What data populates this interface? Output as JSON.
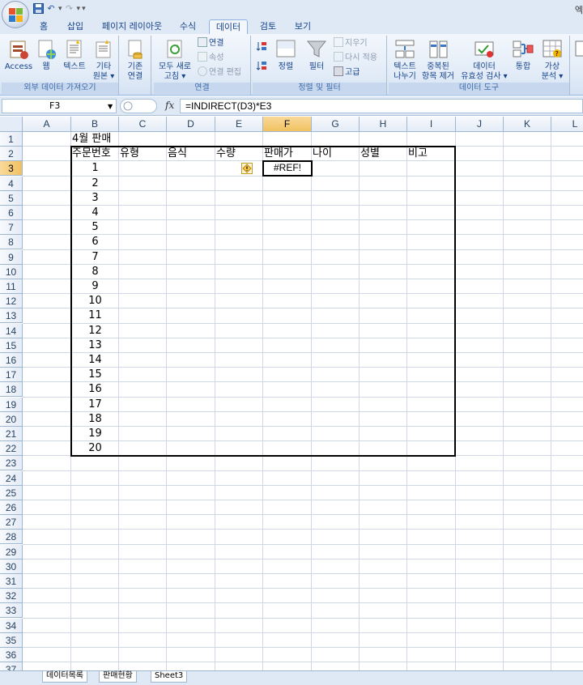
{
  "title_right": "엑",
  "qat": {
    "save": "💾",
    "undo": "↶",
    "redo": "↷",
    "more": "▾"
  },
  "tabs": [
    "홈",
    "삽입",
    "페이지 레이아웃",
    "수식",
    "데이터",
    "검토",
    "보기"
  ],
  "active_tab": "데이터",
  "ribbon": {
    "groups": {
      "external": {
        "label": "외부 데이터 가져오기",
        "buttons": [
          "Access",
          "웹",
          "텍스트",
          "기타",
          "원본 ▾"
        ]
      },
      "existing": {
        "line1": "기존",
        "line2": "연결"
      },
      "connections": {
        "label": "연결",
        "refresh_line1": "모두 새로",
        "refresh_line2": "고침 ▾",
        "connect": "연결",
        "properties": "속성",
        "edit_links": "연결 편집"
      },
      "sort_filter": {
        "label": "정렬 및 필터",
        "sort": "정렬",
        "filter": "필터",
        "clear": "지우기",
        "reapply": "다시 적용",
        "advanced": "고급"
      },
      "data_tools": {
        "label": "데이터 도구",
        "text_to_columns_1": "텍스트",
        "text_to_columns_2": "나누기",
        "remove_dup_1": "중복된",
        "remove_dup_2": "항목 제거",
        "validation_1": "데이터",
        "validation_2": "유효성 검사 ▾",
        "consolidate": "통합",
        "whatif_1": "가상",
        "whatif_2": "분석 ▾"
      }
    }
  },
  "formula_bar": {
    "name_box": "F3",
    "fx": "fx",
    "formula": "=INDIRECT(D3)*E3"
  },
  "columns": [
    "A",
    "B",
    "C",
    "D",
    "E",
    "F",
    "G",
    "H",
    "I",
    "J",
    "K",
    "L"
  ],
  "selected_column": "F",
  "selected_row": "3",
  "rows": [
    "1",
    "2",
    "3",
    "4",
    "5",
    "6",
    "7",
    "8",
    "9",
    "10",
    "11",
    "12",
    "13",
    "14",
    "15",
    "16",
    "17",
    "18",
    "19",
    "20",
    "21",
    "22",
    "23",
    "24",
    "25",
    "26",
    "27",
    "28",
    "29",
    "30",
    "31",
    "32",
    "33",
    "34",
    "35",
    "36",
    "37"
  ],
  "sheet": {
    "title": "4월 판매",
    "headers": [
      "주문번호",
      "유형",
      "음식",
      "수량",
      "판매가",
      "나이",
      "성별",
      "비고"
    ],
    "order_numbers": [
      "1",
      "2",
      "3",
      "4",
      "5",
      "6",
      "7",
      "8",
      "9",
      "10",
      "11",
      "12",
      "13",
      "14",
      "15",
      "16",
      "17",
      "18",
      "19",
      "20"
    ],
    "f3_value": "#REF!"
  },
  "sheet_tabs": [
    "데이터목록",
    "판매현황",
    "Sheet3"
  ]
}
